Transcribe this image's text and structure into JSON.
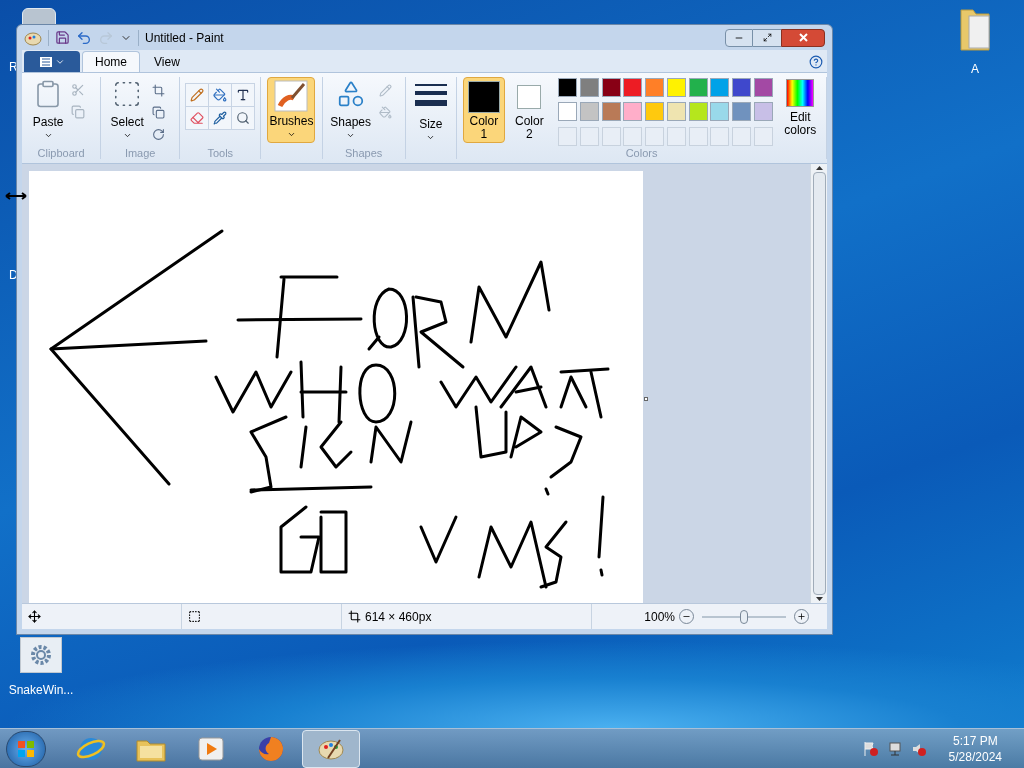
{
  "desktop": {
    "left_labels": [
      "R",
      "D"
    ],
    "folder_icon": {
      "label": "A"
    },
    "program_icon": {
      "label": "SnakeWin..."
    }
  },
  "window": {
    "title": "Untitled - Paint"
  },
  "tabs": [
    {
      "label": "Home",
      "selected": true
    },
    {
      "label": "View",
      "selected": false
    }
  ],
  "ribbon": {
    "clipboard": {
      "label": "Clipboard",
      "paste": "Paste"
    },
    "image": {
      "label": "Image",
      "select": "Select"
    },
    "tools": {
      "label": "Tools"
    },
    "brushes": {
      "button": "Brushes",
      "selected": true
    },
    "shapes": {
      "label": "Shapes",
      "button": "Shapes"
    },
    "size": {
      "button": "Size"
    },
    "colors": {
      "label": "Colors",
      "edit": "Edit colors",
      "color1": {
        "label": "Color 1",
        "selected": true,
        "color": "#000000"
      },
      "color2": {
        "label": "Color 2",
        "selected": false,
        "color": "#ffffff"
      },
      "palette": [
        {
          "color": "#000000"
        },
        {
          "color": "#7f7f7f"
        },
        {
          "color": "#880015"
        },
        {
          "color": "#ed1c24"
        },
        {
          "color": "#ff7f27"
        },
        {
          "color": "#fff200"
        },
        {
          "color": "#22b14c"
        },
        {
          "color": "#00a2e8"
        },
        {
          "color": "#3f48cc"
        },
        {
          "color": "#a349a4"
        },
        {
          "color": "#ffffff"
        },
        {
          "color": "#c3c3c3"
        },
        {
          "color": "#b97a57"
        },
        {
          "color": "#ffaec9"
        },
        {
          "color": "#ffc90e"
        },
        {
          "color": "#efe4b0"
        },
        {
          "color": "#b5e61d"
        },
        {
          "color": "#99d9ea"
        },
        {
          "color": "#7092be"
        },
        {
          "color": "#c8bfe7"
        }
      ]
    }
  },
  "status_bar": {
    "size": "614 × 460px",
    "zoom": "100%",
    "zoom_slider": {
      "level": 0.5
    }
  },
  "taskbar": {
    "items": [
      {
        "kind": "browser",
        "selected": false
      },
      {
        "kind": "folder",
        "selected": false
      },
      {
        "kind": "media",
        "selected": false
      },
      {
        "kind": "firefox",
        "selected": false
      },
      {
        "kind": "paint",
        "selected": true
      }
    ],
    "clock": {
      "time": "5:17 PM",
      "date": "5/28/2024"
    }
  }
}
